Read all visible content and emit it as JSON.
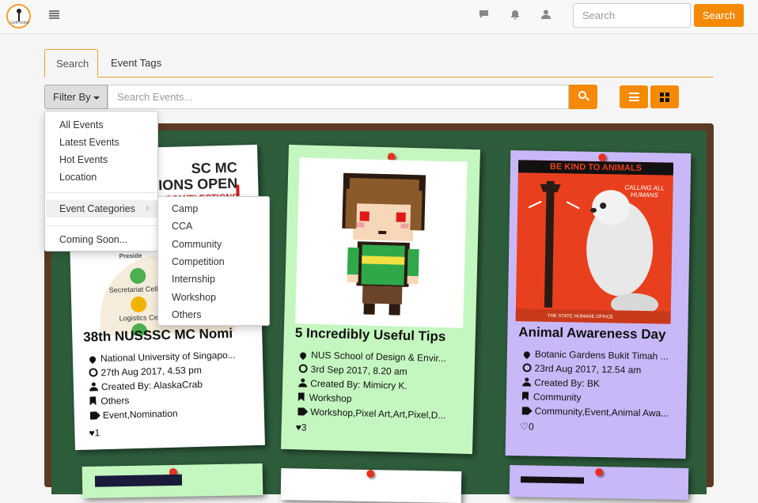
{
  "navbar": {
    "logo_text": "GetPosted",
    "search_placeholder": "Search",
    "search_button": "Search"
  },
  "tabs": [
    {
      "label": "Search",
      "active": true
    },
    {
      "label": "Event Tags",
      "active": false
    }
  ],
  "filter": {
    "button_label": "Filter By",
    "search_placeholder": "Search Events...",
    "menu": [
      "All Events",
      "Latest Events",
      "Hot Events",
      "Location",
      "Event Categories",
      "Coming Soon..."
    ],
    "categories": [
      "Camp",
      "CCA",
      "Community",
      "Competition",
      "Internship",
      "Workshop",
      "Others"
    ]
  },
  "poster_1": {
    "lines": [
      "SC MC",
      "IONS OPEN",
      "COM/ELECTIONS"
    ],
    "cells": [
      "Secretariat Cell",
      "Logistics Cell"
    ],
    "partial": "Preside"
  },
  "poster_3": {
    "top": "BE KIND TO ANIMALS",
    "slogan": "CALLING ALL HUMANS",
    "footer": "THE STATE HUMANE OFFICE"
  },
  "events": [
    {
      "title": "38th NUSSSC MC Nomi",
      "location": "National University of Singapo...",
      "datetime": "27th Aug 2017, 4.53 pm",
      "created_by": "Created By: AlaskaCrab",
      "category": "Others",
      "tags": "Event,Nomination",
      "likes": "1"
    },
    {
      "title": "5 Incredibly Useful Tips",
      "location": "NUS School of Design & Envir...",
      "datetime": "3rd Sep 2017, 8.20 am",
      "created_by": "Created By: Mimicry K.",
      "category": "Workshop",
      "tags": "Workshop,Pixel Art,Art,Pixel,D...",
      "likes": "3"
    },
    {
      "title": "Animal Awareness Day",
      "location": "Botanic Gardens Bukit Timah ...",
      "datetime": "23rd Aug 2017, 12.54 am",
      "created_by": "Created By: BK",
      "category": "Community",
      "tags": "Community,Event,Animal Awa...",
      "likes": "0"
    }
  ],
  "colors": {
    "accent": "#f58a07",
    "board_green": "#2e5d3c",
    "card_green": "#c4f7c0",
    "card_purple": "#c9b8f8",
    "pin_red": "#e53322"
  }
}
